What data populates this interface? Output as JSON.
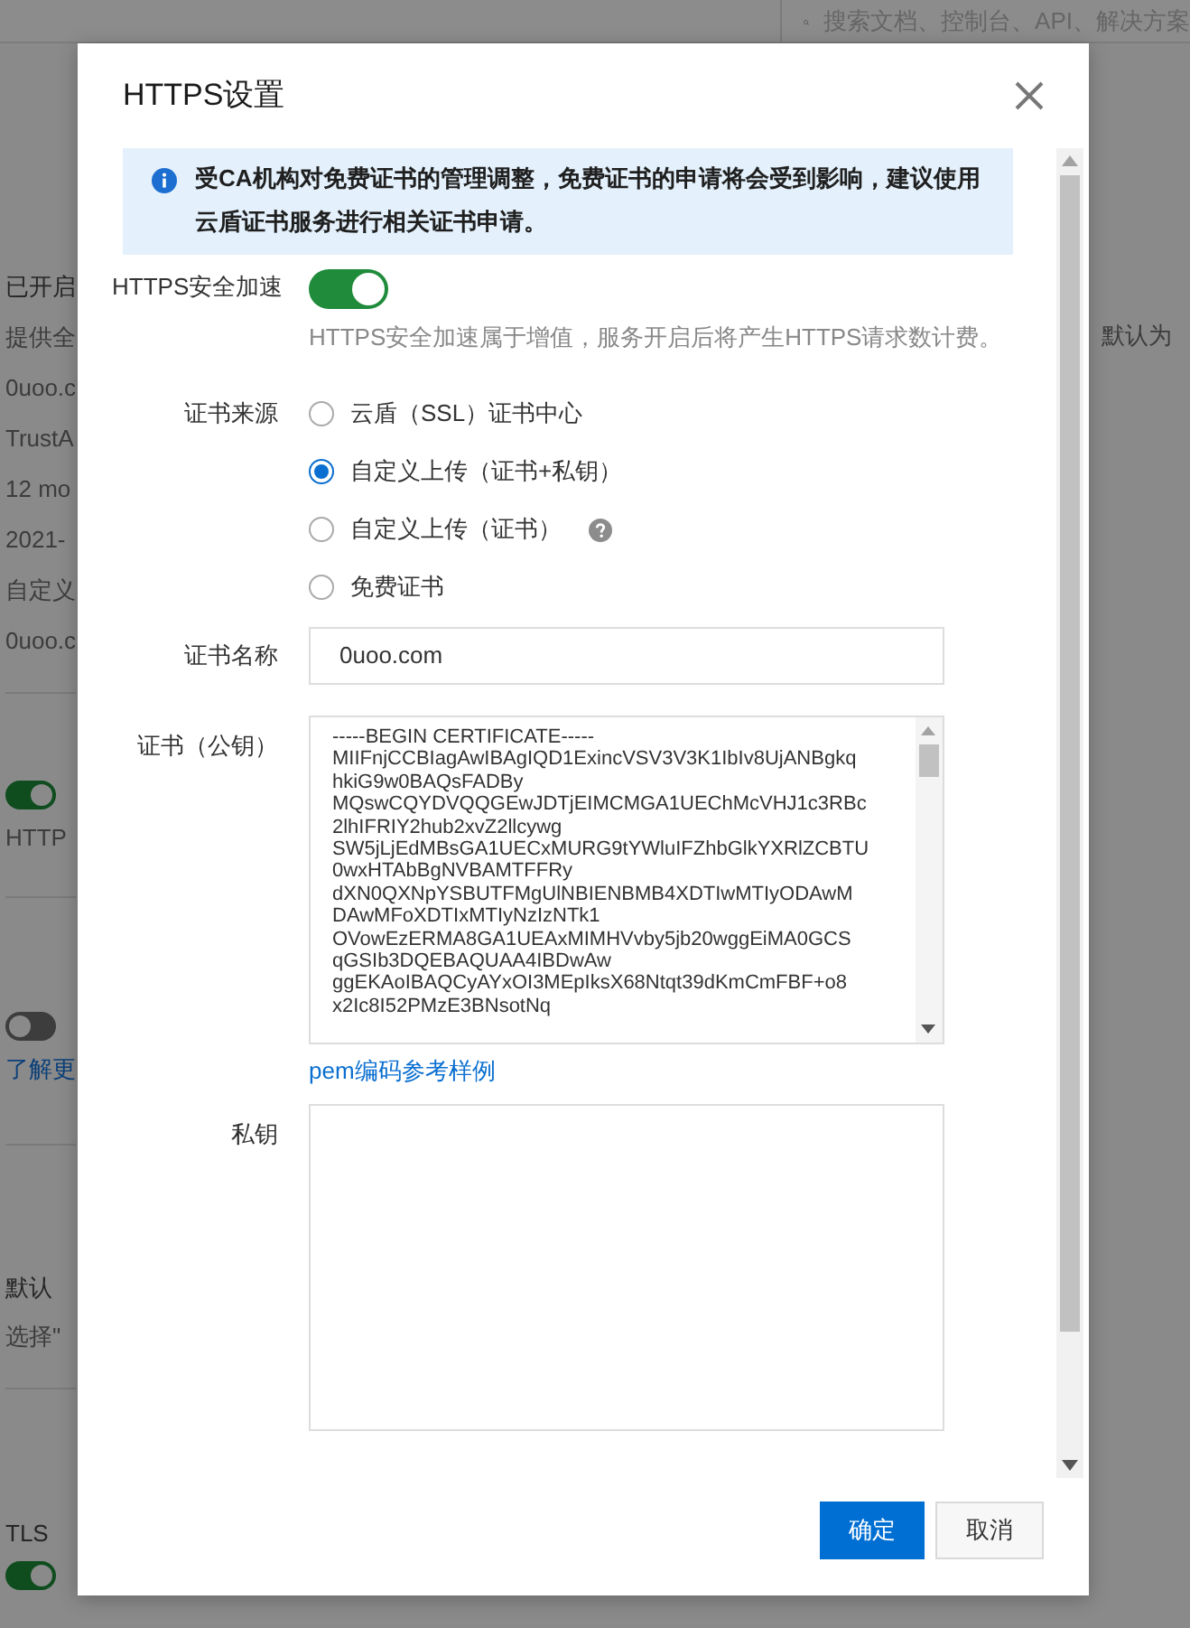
{
  "header": {
    "search": {
      "placeholder": "搜索文档、控制台、API、解决方案"
    }
  },
  "background": {
    "sections": [
      {
        "items": [
          {
            "kind": "text",
            "text": "已开启"
          },
          {
            "kind": "muted",
            "text": "提供全"
          },
          {
            "kind": "muted",
            "text": "0uoo.c"
          },
          {
            "kind": "muted",
            "text": "TrustA"
          },
          {
            "kind": "muted",
            "text": "12 mo"
          },
          {
            "kind": "muted",
            "text": "2021-"
          },
          {
            "kind": "muted",
            "text": "自定义"
          },
          {
            "kind": "muted",
            "text": "0uoo.c"
          }
        ]
      },
      {
        "items": [
          {
            "kind": "switch",
            "on": true
          },
          {
            "kind": "muted",
            "text": "HTTP"
          }
        ]
      },
      {
        "items": [
          {
            "kind": "switch",
            "on": false
          },
          {
            "kind": "link",
            "text": "了解更"
          }
        ]
      },
      {
        "items": [
          {
            "kind": "text",
            "text": "默认"
          },
          {
            "kind": "muted",
            "text": "选择\""
          }
        ]
      },
      {
        "items": [
          {
            "kind": "text",
            "text": "TLS"
          },
          {
            "kind": "switch",
            "on": true
          }
        ]
      }
    ],
    "right_text": "默认为"
  },
  "dialog": {
    "title": "HTTPS设置",
    "alert": "受CA机构对免费证书的管理调整，免费证书的申请将会受到影响，建议使用云盾证书服务进行相关证书申请。",
    "acceleration": {
      "label": "HTTPS安全加速",
      "on": true,
      "hint": "HTTPS安全加速属于增值，服务开启后将产生HTTPS请求数计费。"
    },
    "source": {
      "label": "证书来源",
      "options": [
        {
          "label": "云盾（SSL）证书中心",
          "selected": false,
          "help": false
        },
        {
          "label": "自定义上传（证书+私钥）",
          "selected": true,
          "help": false
        },
        {
          "label": "自定义上传（证书）",
          "selected": false,
          "help": true
        },
        {
          "label": "免费证书",
          "selected": false,
          "help": false
        }
      ]
    },
    "name": {
      "label": "证书名称",
      "value": "0uoo.com"
    },
    "certificate": {
      "label": "证书（公钥）",
      "value": "-----BEGIN CERTIFICATE-----\nMIIFnjCCBIagAwIBAgIQD1ExincVSV3V3K1IbIv8UjANBgkq\nhkiG9w0BAQsFADBy\nMQswCQYDVQQGEwJDTjEIMCMGA1UEChMcVHJ1c3RBc\n2lhIFRIY2hub2xvZ2llcywg\nSW5jLjEdMBsGA1UECxMURG9tYWluIFZhbGlkYXRlZCBTU\n0wxHTAbBgNVBAMTFFRy\ndXN0QXNpYSBUTFMgUlNBIENBMB4XDTIwMTIyODAwM\nDAwMFoXDTIxMTIyNzIzNTk1\nOVowEzERMA8GA1UEAxMIMHVvby5jb20wggEiMA0GCS\nqGSIb3DQEBAQUAA4IBDwAw\nggEKAoIBAQCyAYxOI3MEpIksX68Ntqt39dKmCmFBF+o8\nx2Ic8I52PMzE3BNsotNq",
      "link": "pem编码参考样例"
    },
    "private_key": {
      "label": "私钥"
    },
    "buttons": [
      {
        "label": "确定",
        "kind": "primary"
      },
      {
        "label": "取消",
        "kind": "secondary"
      }
    ]
  }
}
